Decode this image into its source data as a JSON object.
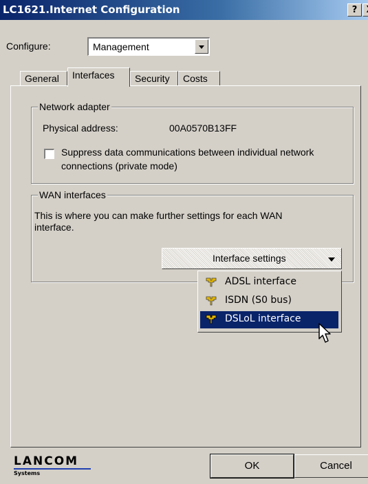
{
  "window": {
    "title": "LC1621.Internet Configuration",
    "help_label": "?",
    "close_label": "X"
  },
  "configure": {
    "label": "Configure:",
    "value": "Management"
  },
  "tabs": [
    {
      "label": "General"
    },
    {
      "label": "Interfaces",
      "active": true
    },
    {
      "label": "Security"
    },
    {
      "label": "Costs"
    }
  ],
  "network_adapter": {
    "legend": "Network adapter",
    "physical_address_label": "Physical address:",
    "physical_address_value": "00A0570B13FF",
    "private_mode_line1": "Suppress data communications between individual network",
    "private_mode_line2": "connections (private mode)",
    "private_mode_checked": false
  },
  "wan_interfaces": {
    "legend": "WAN interfaces",
    "description_line1": "This is where you can make further settings for each WAN",
    "description_line2": "interface.",
    "interface_settings_label": "Interface settings"
  },
  "menu": {
    "items": [
      {
        "label": "ADSL interface",
        "icon": "interface-plug-icon",
        "selected": false
      },
      {
        "label": "ISDN (S0 bus)",
        "icon": "interface-plug-icon",
        "selected": false
      },
      {
        "label": "DSLoL interface",
        "icon": "interface-plug-icon",
        "selected": true
      }
    ]
  },
  "footer": {
    "logo_main": "LANCOM",
    "logo_sub": "Systems",
    "ok_label": "OK",
    "cancel_label": "Cancel"
  },
  "colors": {
    "title_bar": "#0a246a",
    "dialog_face": "#d4d0c8",
    "selection": "#0a246a",
    "logo_line": "#1f3fb0"
  }
}
